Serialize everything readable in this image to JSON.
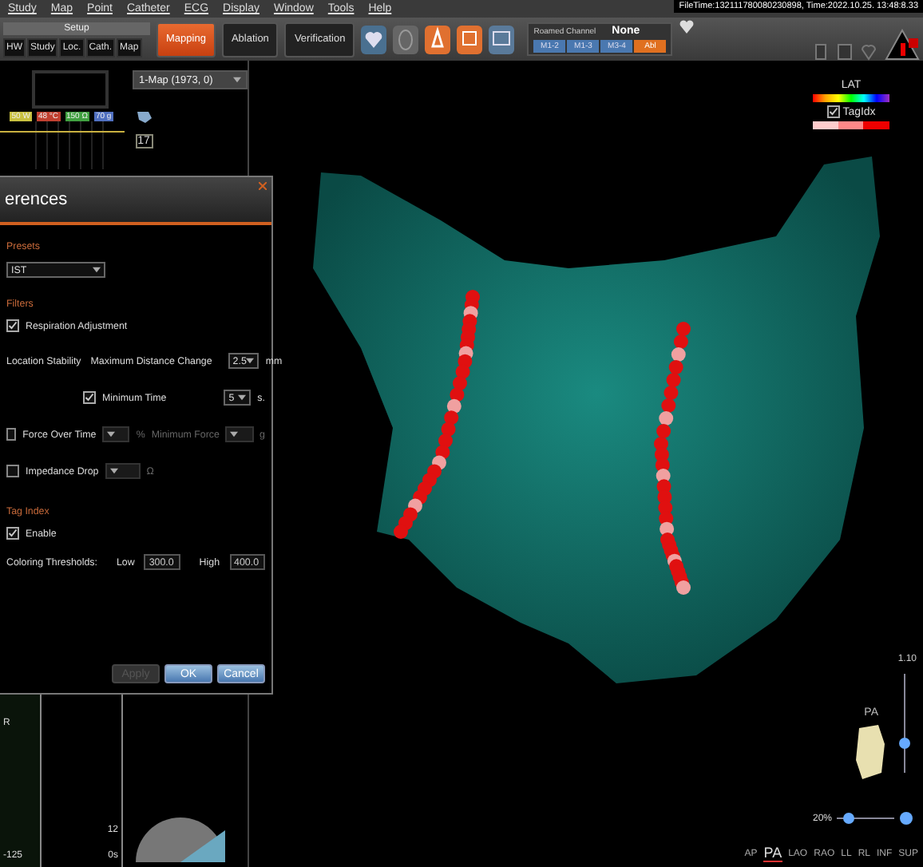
{
  "menu": [
    "Study",
    "Map",
    "Point",
    "Catheter",
    "ECG",
    "Display",
    "Window",
    "Tools",
    "Help"
  ],
  "toolbar": {
    "setup": "Setup",
    "setup_tabs": [
      "HW",
      "Study",
      "Loc.",
      "Cath.",
      "Map"
    ],
    "modes": [
      {
        "label": "Mapping",
        "selected": true
      },
      {
        "label": "Ablation",
        "selected": false
      },
      {
        "label": "Verification",
        "selected": false
      }
    ],
    "roamed_channel": {
      "label": "Roamed Channel",
      "value": "None"
    },
    "channel_buttons": [
      {
        "label": "M1-2",
        "selected": false
      },
      {
        "label": "M1-3",
        "selected": false
      },
      {
        "label": "M3-4",
        "selected": false
      },
      {
        "label": "Abl",
        "selected": true
      }
    ],
    "file_time": "FileTime:132111780080230898, Time:2022.10.25. 13:48:8.33"
  },
  "left_panel": {
    "readings": [
      {
        "text": "50 W",
        "color": "#c8c040"
      },
      {
        "text": "48 °C",
        "color": "#c04030"
      },
      {
        "text": "150 Ω",
        "color": "#40a040"
      },
      {
        "text": "70 g",
        "color": "#5070c0"
      }
    ],
    "map_select": "1-Map (1973, 0)",
    "counter": "17"
  },
  "ecg": {
    "lead": "R",
    "min": "-125",
    "max": "12",
    "time": "0s"
  },
  "dialog": {
    "title": "erences",
    "presets_label": "Presets",
    "preset": "IST",
    "filters_label": "Filters",
    "respiration": {
      "label": "Respiration Adjustment",
      "checked": true
    },
    "location_stability_label": "Location Stability",
    "max_distance": {
      "label": "Maximum Distance Change",
      "value": "2.5",
      "unit": "mm"
    },
    "min_time": {
      "label": "Minimum Time",
      "checked": true,
      "value": "5",
      "unit": "s."
    },
    "force_over_time": {
      "label": "Force Over Time",
      "checked": false,
      "unit": "%"
    },
    "min_force": {
      "label": "Minimum Force",
      "disabled": true,
      "unit": "g"
    },
    "impedance_drop": {
      "label": "Impedance Drop",
      "checked": false,
      "unit": "Ω"
    },
    "tag_index_label": "Tag Index",
    "enable": {
      "label": "Enable",
      "checked": true
    },
    "thresholds": {
      "label": "Coloring Thresholds:",
      "low_label": "Low",
      "low": "300.0",
      "high_label": "High",
      "high": "400.0"
    },
    "buttons": [
      {
        "label": "Apply",
        "disabled": true
      },
      {
        "label": "OK",
        "disabled": false
      },
      {
        "label": "Cancel",
        "disabled": false
      }
    ]
  },
  "legend": {
    "lat_label": "LAT",
    "tag_idx": {
      "label": "TagIdx",
      "checked": true
    }
  },
  "view": {
    "scale": "1.10",
    "orientation": "PA",
    "zoom": "20%",
    "rotation_slider": {
      "level": 0.3
    },
    "zoom_slider": {
      "level": 0.2
    },
    "views": [
      {
        "label": "AP",
        "selected": false
      },
      {
        "label": "PA",
        "selected": true
      },
      {
        "label": "LAO",
        "selected": false
      },
      {
        "label": "RAO",
        "selected": false
      },
      {
        "label": "LL",
        "selected": false
      },
      {
        "label": "RL",
        "selected": false
      },
      {
        "label": "INF",
        "selected": false
      },
      {
        "label": "SUP",
        "selected": false
      }
    ]
  }
}
